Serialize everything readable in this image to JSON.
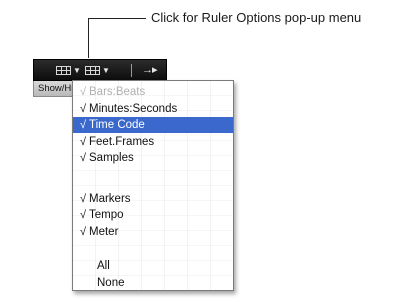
{
  "callout": {
    "text": "Click for Ruler Options pop-up menu"
  },
  "toolbar": {
    "buttons": [
      {
        "icon": "grid-view-icon"
      },
      {
        "icon": "grid-view-icon"
      },
      {
        "icon": "nudge-arrow-icon",
        "glyph": "→▸"
      }
    ]
  },
  "show_hide": {
    "label": "Show/Hide"
  },
  "ruler_menu": {
    "items": [
      {
        "label": "Bars:Beats",
        "checked": true,
        "disabled": true,
        "selected": false
      },
      {
        "label": "Minutes:Seconds",
        "checked": true,
        "disabled": false,
        "selected": false
      },
      {
        "label": "Time Code",
        "checked": true,
        "disabled": false,
        "selected": true
      },
      {
        "label": "Feet.Frames",
        "checked": true,
        "disabled": false,
        "selected": false
      },
      {
        "label": "Samples",
        "checked": true,
        "disabled": false,
        "selected": false
      },
      {
        "label": "Markers",
        "checked": true,
        "disabled": false,
        "selected": false
      },
      {
        "label": "Tempo",
        "checked": true,
        "disabled": false,
        "selected": false
      },
      {
        "label": "Meter",
        "checked": true,
        "disabled": false,
        "selected": false
      },
      {
        "label": "All",
        "checked": false,
        "disabled": false,
        "selected": false
      },
      {
        "label": "None",
        "checked": false,
        "disabled": false,
        "selected": false
      }
    ],
    "check_glyph": "√"
  },
  "colors": {
    "selection": "#3a68cc",
    "toolbar_bg": "#111111"
  }
}
